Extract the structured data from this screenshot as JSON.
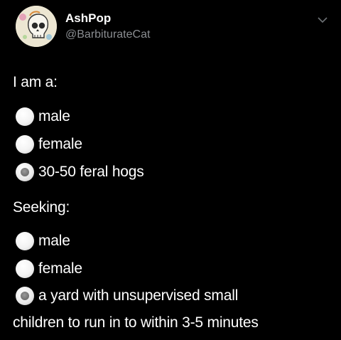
{
  "header": {
    "display_name": "AshPop",
    "handle": "@BarbiturateCat",
    "menu_icon": "chevron-down-icon"
  },
  "post": {
    "intro": "I am a:",
    "identity_options": [
      {
        "label": "male",
        "checked": false
      },
      {
        "label": "female",
        "checked": false
      },
      {
        "label": "30-50 feral hogs",
        "checked": true
      }
    ],
    "seeking_heading": "Seeking:",
    "seeking_options": [
      {
        "label": "male",
        "checked": false
      },
      {
        "label": "female",
        "checked": false
      },
      {
        "label": "a yard with unsupervised small",
        "checked": true
      }
    ],
    "seeking_continuation": "children to run in to within 3-5 minutes"
  },
  "colors": {
    "background": "#000000",
    "text": "#ffffff",
    "handle": "#8a8d91"
  }
}
